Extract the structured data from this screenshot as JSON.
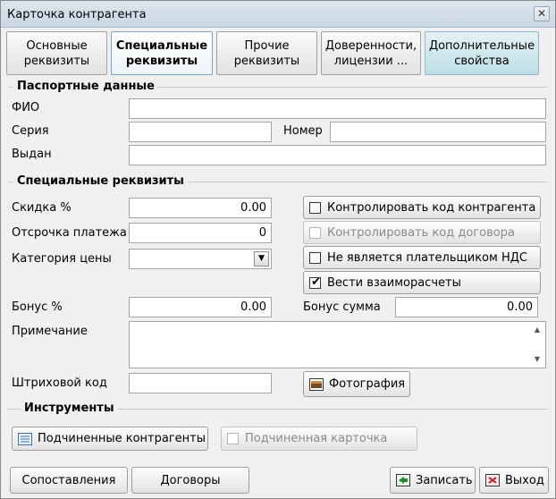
{
  "window": {
    "title": "Карточка контрагента",
    "close_glyph": "✕"
  },
  "tabs": [
    {
      "line1": "Основные",
      "line2": "реквизиты"
    },
    {
      "line1": "Специальные",
      "line2": "реквизиты"
    },
    {
      "line1": "Прочие",
      "line2": "реквизиты"
    },
    {
      "line1": "Доверенности,",
      "line2": "лицензии ..."
    },
    {
      "line1": "Дополнительные",
      "line2": "свойства"
    }
  ],
  "passport": {
    "section_title": "Паспортные данные",
    "fio_label": "ФИО",
    "fio_value": "",
    "series_label": "Серия",
    "series_value": "",
    "number_label": "Номер",
    "number_value": "",
    "issued_label": "Выдан",
    "issued_value": ""
  },
  "special": {
    "section_title": "Специальные реквизиты",
    "discount_label": "Скидка %",
    "discount_value": "0.00",
    "delay_label": "Отсрочка платежа",
    "delay_value": "0",
    "price_cat_label": "Категория цены",
    "price_cat_value": "",
    "bonus_pct_label": "Бонус %",
    "bonus_pct_value": "0.00",
    "bonus_sum_label": "Бонус сумма",
    "bonus_sum_value": "0.00",
    "note_label": "Примечание",
    "note_value": "",
    "barcode_label": "Штриховой код",
    "barcode_value": "",
    "check_contractor_code": "Контролировать код контрагента",
    "check_contract_code": "Контролировать код договора",
    "not_vat_payer": "Не является плательщиком НДС",
    "keep_settlements": "Вести взаиморасчеты",
    "photo_button": "Фотография"
  },
  "tools": {
    "section_title": "Инструменты",
    "subordinate_contractors": "Подчиненные контрагенты",
    "subordinate_card": "Подчиненная карточка"
  },
  "footer": {
    "comparisons": "Сопоставления",
    "contracts": "Договоры",
    "save": "Записать",
    "exit": "Выход"
  },
  "icons": {
    "combo": "▼",
    "scroll_up": "▲",
    "scroll_down": "▼",
    "tick": "✔"
  }
}
